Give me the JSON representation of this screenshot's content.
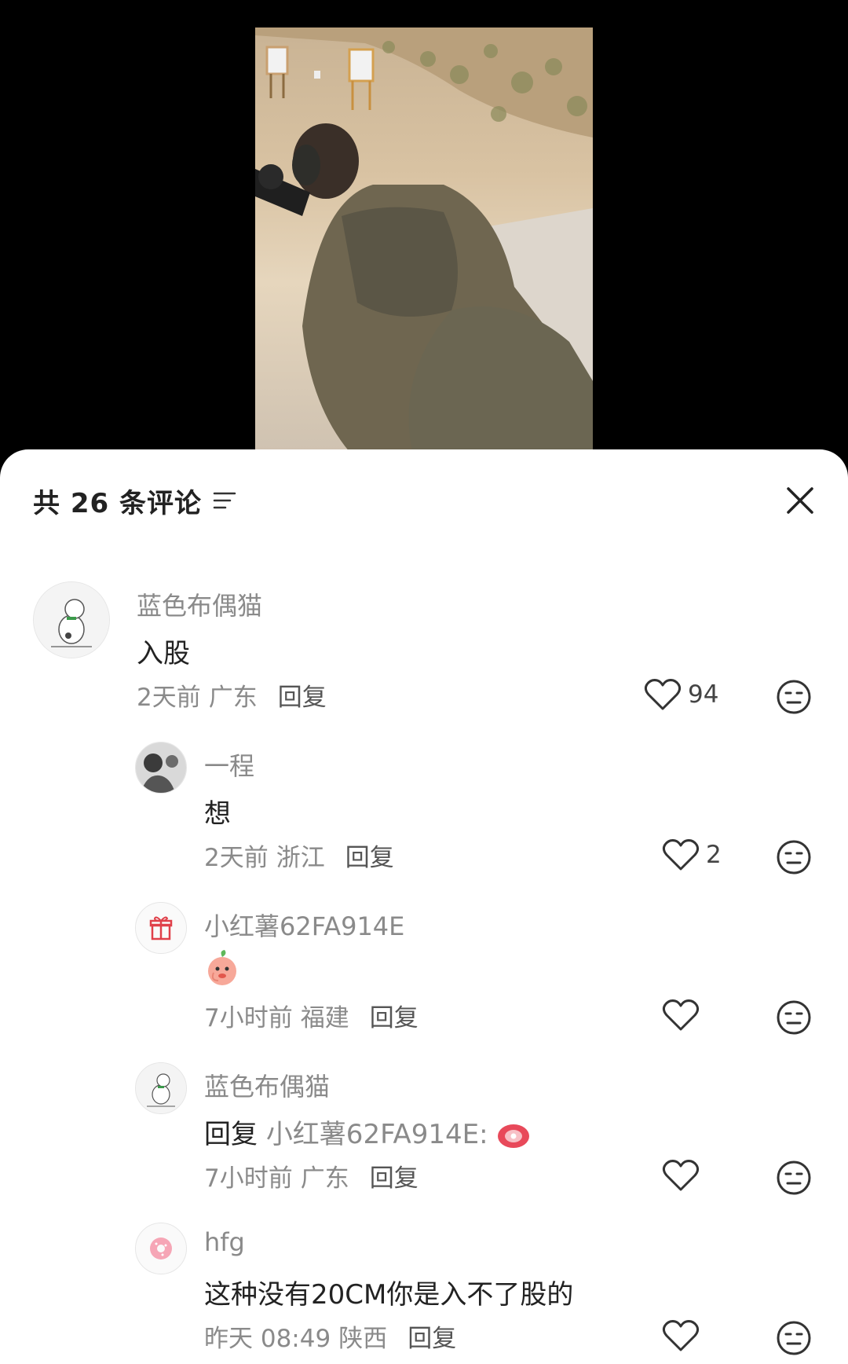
{
  "header": {
    "title": "共 26 条评论"
  },
  "comments": [
    {
      "user": "蓝色布偶猫",
      "text": "入股",
      "time": "2天前",
      "location": "广东",
      "reply_label": "回复",
      "likes": "94"
    },
    {
      "user": "一程",
      "text": "想",
      "time": "2天前",
      "location": "浙江",
      "reply_label": "回复",
      "likes": "2"
    },
    {
      "user": "小红薯62FA914E",
      "text": "",
      "time": "7小时前",
      "location": "福建",
      "reply_label": "回复",
      "likes": ""
    },
    {
      "user": "蓝色布偶猫",
      "text_prefix": "回复",
      "reply_target": "小红薯62FA914E:",
      "time": "7小时前",
      "location": "广东",
      "reply_label": "回复",
      "likes": ""
    },
    {
      "user": "hfg",
      "text": "这种没有20CM你是入不了股的",
      "time": "昨天 08:49",
      "location": "陕西",
      "reply_label": "回复",
      "likes": ""
    }
  ],
  "icons": {
    "sort": "sort-lines-icon",
    "close": "close-icon",
    "like": "heart-outline-icon",
    "dislike": "meh-face-icon",
    "sticker_peach": "peach-sticker-icon",
    "sticker_ham": "ham-sticker-icon"
  },
  "colors": {
    "accent": "#222222",
    "muted": "#8a8a8a",
    "background": "#ffffff"
  }
}
